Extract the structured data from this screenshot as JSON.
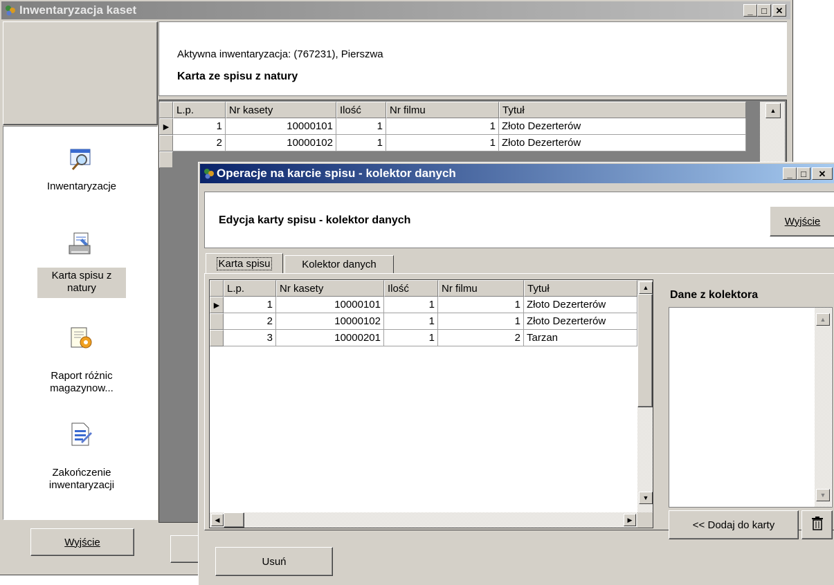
{
  "main_window": {
    "title": "Inwentaryzacja kaset",
    "active_label": "Aktywna inwentaryzacja: (767231), Pierszwa",
    "section_title": "Karta ze spisu z natury",
    "columns": [
      "L.p.",
      "Nr kasety",
      "Ilość",
      "Nr filmu",
      "Tytuł"
    ],
    "rows": [
      [
        "1",
        "10000101",
        "1",
        "1",
        "Złoto Dezerterów"
      ],
      [
        "2",
        "10000102",
        "1",
        "1",
        "Złoto Dezerterów"
      ]
    ],
    "exit_label": "Wyjście"
  },
  "sidebar": {
    "items": [
      {
        "label": "Inwentaryzacje",
        "icon": "magnifier-window-icon"
      },
      {
        "label": "Karta spisu z natury",
        "icon": "printer-doc-icon"
      },
      {
        "label": "Raport różnic magazynow...",
        "icon": "report-gear-icon"
      },
      {
        "label": "Zakończenie inwentaryzacji",
        "icon": "doc-pen-icon"
      }
    ],
    "exit_label": "Wyjście"
  },
  "dialog": {
    "title": "Operacje na karcie spisu - kolektor danych",
    "heading": "Edycja karty spisu - kolektor danych",
    "exit_label": "Wyjście",
    "tabs": [
      "Karta spisu",
      "Kolektor danych"
    ],
    "columns": [
      "L.p.",
      "Nr kasety",
      "Ilość",
      "Nr filmu",
      "Tytuł"
    ],
    "rows": [
      [
        "1",
        "10000101",
        "1",
        "1",
        "Złoto Dezerterów"
      ],
      [
        "2",
        "10000102",
        "1",
        "1",
        "Złoto Dezerterów"
      ],
      [
        "3",
        "10000201",
        "1",
        "2",
        "Tarzan"
      ]
    ],
    "collector_title": "Dane z kolektora",
    "add_button": "<< Dodaj do karty",
    "delete_label": "Usuń"
  },
  "colors": {
    "active_title": "#0a246a",
    "face": "#d4d0c8"
  }
}
